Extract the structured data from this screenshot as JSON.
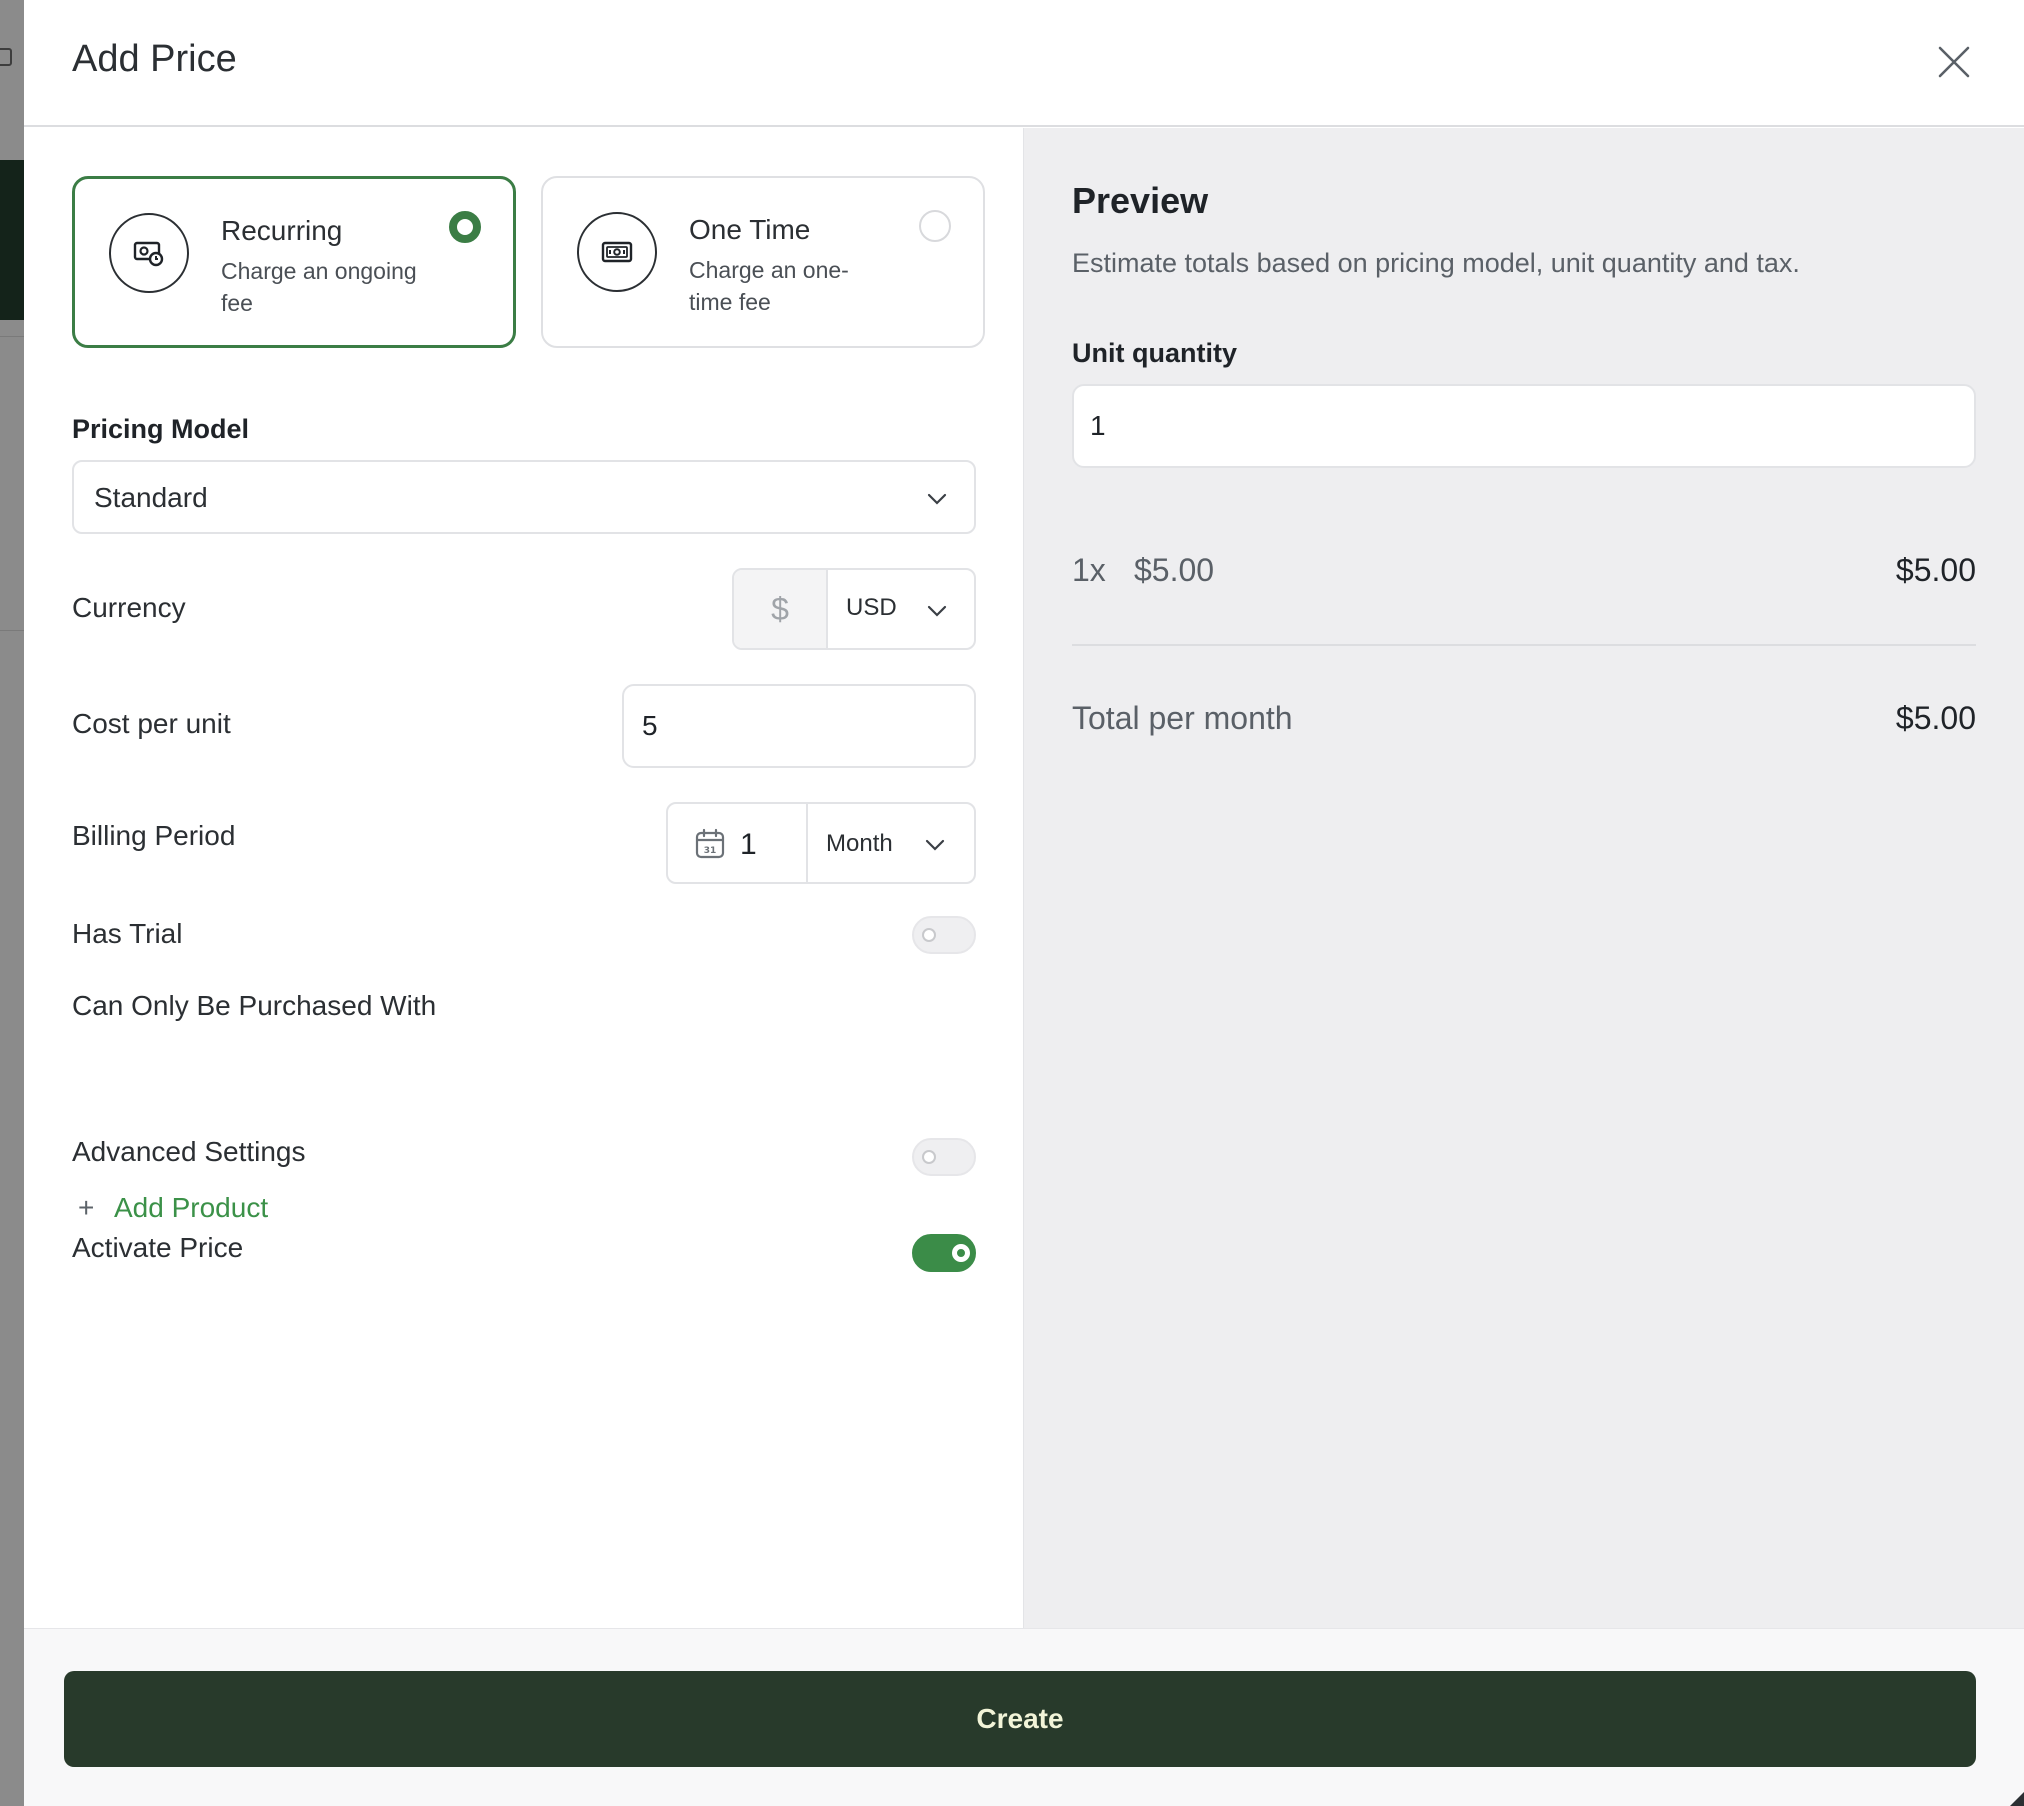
{
  "modal": {
    "title": "Add Price"
  },
  "types": [
    {
      "title": "Recurring",
      "subtitle": "Charge an ongoing fee",
      "selected": true,
      "icon": "recurring-cash-icon"
    },
    {
      "title": "One Time",
      "subtitle": "Charge an one-time fee",
      "selected": false,
      "icon": "banknote-icon"
    }
  ],
  "form": {
    "pricing_model_label": "Pricing Model",
    "pricing_model_value": "Standard",
    "currency_label": "Currency",
    "currency_symbol": "$",
    "currency_code": "USD",
    "cost_label": "Cost per unit",
    "cost_value": "5",
    "billing_label": "Billing Period",
    "billing_count": "1",
    "billing_unit": "Month",
    "trial_label": "Has Trial",
    "trial_on": false,
    "purchased_with_label": "Can Only Be Purchased With",
    "add_product_label": "Add Product",
    "advanced_label": "Advanced Settings",
    "advanced_on": false,
    "activate_label": "Activate Price",
    "activate_on": true
  },
  "preview": {
    "title": "Preview",
    "description": "Estimate totals based on pricing model, unit quantity and tax.",
    "unit_quantity_label": "Unit quantity",
    "unit_quantity_value": "1",
    "line_qty": "1x",
    "line_unit_price": "$5.00",
    "line_total": "$5.00",
    "total_label": "Total per month",
    "total_value": "$5.00"
  },
  "footer": {
    "create_label": "Create"
  },
  "colors": {
    "accent": "#3b7d45",
    "button": "#283a2b",
    "link": "#3b9148"
  }
}
